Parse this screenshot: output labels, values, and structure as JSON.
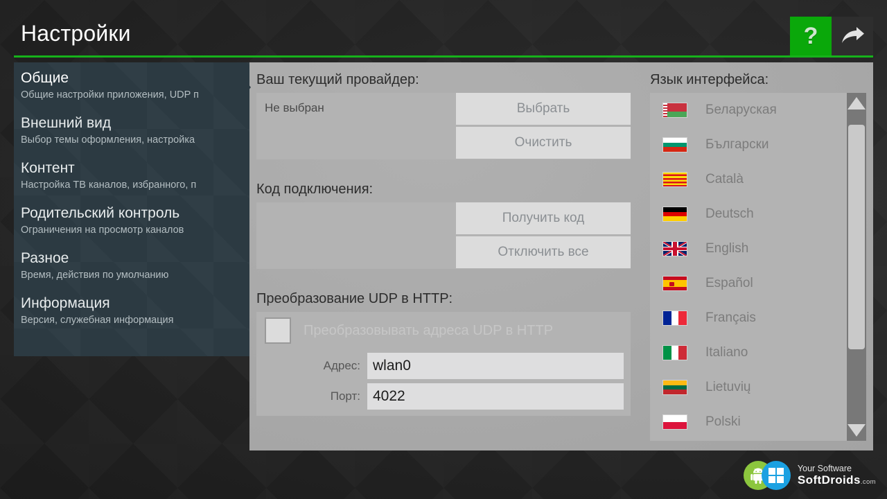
{
  "header": {
    "title": "Настройки",
    "help_icon": "question-mark-icon",
    "exit_icon": "forward-arrow-icon",
    "accent_color": "#16b21b",
    "help_button_color": "#0aa80a"
  },
  "sidebar": {
    "items": [
      {
        "title": "Общие",
        "subtitle": "Общие настройки приложения, UDP п",
        "selected": true
      },
      {
        "title": "Внешний вид",
        "subtitle": "Выбор темы оформления, настройка",
        "selected": false
      },
      {
        "title": "Контент",
        "subtitle": "Настройка ТВ каналов, избранного, п",
        "selected": false
      },
      {
        "title": "Родительский контроль",
        "subtitle": "Ограничения на просмотр каналов",
        "selected": false
      },
      {
        "title": "Разное",
        "subtitle": "Время, действия по умолчанию",
        "selected": false
      },
      {
        "title": "Информация",
        "subtitle": "Версия, служебная информация",
        "selected": false
      }
    ]
  },
  "main": {
    "provider": {
      "label": "Ваш текущий провайдер:",
      "value": "Не выбран",
      "select_button": "Выбрать",
      "clear_button": "Очистить"
    },
    "connection_code": {
      "label": "Код подключения:",
      "value": "",
      "get_code_button": "Получить код",
      "disable_all_button": "Отключить все"
    },
    "udp_to_http": {
      "label": "Преобразование UDP в HTTP:",
      "checkbox_label": "Преобразовывать адреса UDP в HTTP",
      "checkbox_checked": false,
      "address_label": "Адрес:",
      "address_value": "wlan0",
      "port_label": "Порт:",
      "port_value": "4022"
    }
  },
  "language_panel": {
    "label": "Язык интерфейса:",
    "items": [
      {
        "name": "Беларуская",
        "flag": "flag-belarus"
      },
      {
        "name": "Български",
        "flag": "flag-bulgaria"
      },
      {
        "name": "Català",
        "flag": "flag-catalonia"
      },
      {
        "name": "Deutsch",
        "flag": "flag-germany"
      },
      {
        "name": "English",
        "flag": "flag-united-kingdom"
      },
      {
        "name": "Español",
        "flag": "flag-spain"
      },
      {
        "name": "Français",
        "flag": "flag-france"
      },
      {
        "name": "Italiano",
        "flag": "flag-italy"
      },
      {
        "name": "Lietuvių",
        "flag": "flag-lithuania"
      },
      {
        "name": "Polski",
        "flag": "flag-poland"
      }
    ],
    "scrollbar": {
      "up_arrow": "triangle-up-icon",
      "down_arrow": "triangle-down-icon"
    }
  },
  "watermark": {
    "line1": "Your Software",
    "line2": "SoftDroids",
    "tld": ".com"
  }
}
